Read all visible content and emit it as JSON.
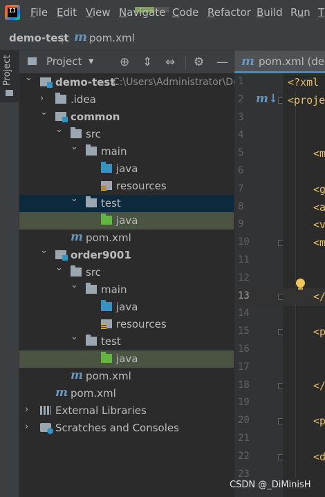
{
  "menubar": {
    "items": [
      "File",
      "Edit",
      "View",
      "Navigate",
      "Code",
      "Refactor",
      "Build",
      "Run",
      "T"
    ],
    "mnemonics": [
      "F",
      "E",
      "V",
      "N",
      "C",
      "R",
      "B",
      "u",
      "T"
    ]
  },
  "breadcrumb": {
    "project": "demo-test",
    "separator": "〉",
    "file": "pom.xml"
  },
  "left_strip": {
    "tab_label": "Project"
  },
  "project_panel": {
    "view_selector": "Project",
    "dropdown_glyph": "▾",
    "toolbar_icons": [
      "target-icon",
      "expand-all-icon",
      "collapse-all-icon",
      "gear-icon",
      "minimize-icon"
    ]
  },
  "tree": [
    {
      "label": "demo-test",
      "hint": "C:\\Users\\Administrator\\De",
      "icon": "module",
      "indent": 0,
      "expanded": true,
      "bold": true
    },
    {
      "label": ".idea",
      "icon": "folder",
      "indent": 1,
      "expanded": false
    },
    {
      "label": "common",
      "icon": "module",
      "indent": 1,
      "expanded": true,
      "bold": true
    },
    {
      "label": "src",
      "icon": "folder",
      "indent": 2,
      "expanded": true
    },
    {
      "label": "main",
      "icon": "folder",
      "indent": 3,
      "expanded": true
    },
    {
      "label": "java",
      "icon": "src",
      "indent": 4
    },
    {
      "label": "resources",
      "icon": "res",
      "indent": 4
    },
    {
      "label": "test",
      "icon": "folder",
      "indent": 3,
      "expanded": true,
      "selected": "dark"
    },
    {
      "label": "java",
      "icon": "test",
      "indent": 4,
      "selected": "green"
    },
    {
      "label": "pom.xml",
      "icon": "maven",
      "indent": 2
    },
    {
      "label": "order9001",
      "icon": "module",
      "indent": 1,
      "expanded": true,
      "bold": true
    },
    {
      "label": "src",
      "icon": "folder",
      "indent": 2,
      "expanded": true
    },
    {
      "label": "main",
      "icon": "folder",
      "indent": 3,
      "expanded": true
    },
    {
      "label": "java",
      "icon": "src",
      "indent": 4
    },
    {
      "label": "resources",
      "icon": "res",
      "indent": 4
    },
    {
      "label": "test",
      "icon": "folder",
      "indent": 3,
      "expanded": true
    },
    {
      "label": "java",
      "icon": "test",
      "indent": 4,
      "selected": "green"
    },
    {
      "label": "pom.xml",
      "icon": "maven",
      "indent": 2
    },
    {
      "label": "pom.xml",
      "icon": "maven",
      "indent": 1
    },
    {
      "label": "External Libraries",
      "icon": "libs",
      "indent": 0,
      "expanded": false
    },
    {
      "label": "Scratches and Consoles",
      "icon": "scratch",
      "indent": 0,
      "expanded": false
    }
  ],
  "editor": {
    "tab_label": "pom.xml (dem",
    "current_line": 13,
    "lines": [
      {
        "n": "1",
        "text": "<?xml",
        "indent": 0
      },
      {
        "n": "2",
        "text": "<proje",
        "indent": 0,
        "fold": true,
        "maven_marker": true
      },
      {
        "n": "3",
        "text": "",
        "indent": 0
      },
      {
        "n": "4",
        "text": "",
        "indent": 0
      },
      {
        "n": "5",
        "text": "<m",
        "indent": 1
      },
      {
        "n": "6",
        "text": "",
        "indent": 0
      },
      {
        "n": "7",
        "text": "<g",
        "indent": 1
      },
      {
        "n": "8",
        "text": "<a",
        "indent": 1
      },
      {
        "n": "9",
        "text": "<v",
        "indent": 1
      },
      {
        "n": "10",
        "text": "<m",
        "indent": 1,
        "fold": true
      },
      {
        "n": "11",
        "text": "",
        "indent": 0
      },
      {
        "n": "12",
        "text": "",
        "indent": 0
      },
      {
        "n": "13",
        "text": "</",
        "indent": 1,
        "fold": true
      },
      {
        "n": "14",
        "text": "",
        "indent": 0
      },
      {
        "n": "15",
        "text": "<p",
        "indent": 1,
        "fold": true
      },
      {
        "n": "16",
        "text": "",
        "indent": 0
      },
      {
        "n": "17",
        "text": "",
        "indent": 0
      },
      {
        "n": "18",
        "text": "</",
        "indent": 1,
        "fold": true
      },
      {
        "n": "19",
        "text": "",
        "indent": 0
      },
      {
        "n": "20",
        "text": "<p",
        "indent": 1,
        "fold": true
      },
      {
        "n": "21",
        "text": "",
        "indent": 0
      },
      {
        "n": "22",
        "text": "<d",
        "indent": 1,
        "fold": true
      },
      {
        "n": "23",
        "text": "",
        "indent": 0
      }
    ]
  },
  "watermark": "CSDN @_DiMinisH",
  "colors": {
    "background": "#2b2b2b",
    "chrome": "#3c3f41",
    "selection_dark": "#0d293e",
    "selection_green": "#4b5443",
    "xml_tag": "#e8bf6a",
    "maven_blue": "#6897bb"
  }
}
